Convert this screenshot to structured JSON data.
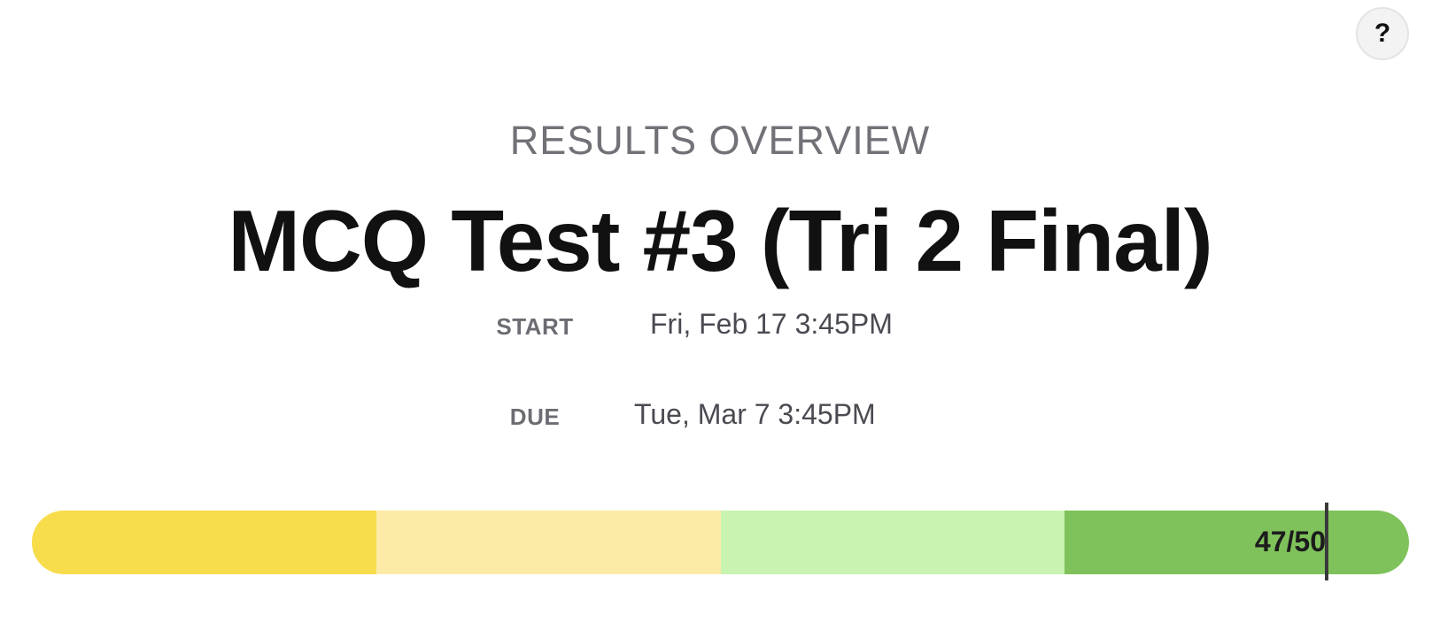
{
  "help": {
    "label": "?"
  },
  "header": {
    "eyebrow": "RESULTS OVERVIEW",
    "title": "MCQ Test #3 (Tri 2 Final)"
  },
  "schedule": {
    "start_label": "START",
    "start_value": "Fri, Feb 17 3:45PM",
    "due_label": "DUE",
    "due_value": "Tue, Mar 7 3:45PM"
  },
  "score": {
    "label": "47/50",
    "earned": 47,
    "total": 50,
    "band_colors": [
      "#f7dc4c",
      "#fbeba6",
      "#c9f3b0",
      "#7fc25b"
    ]
  }
}
